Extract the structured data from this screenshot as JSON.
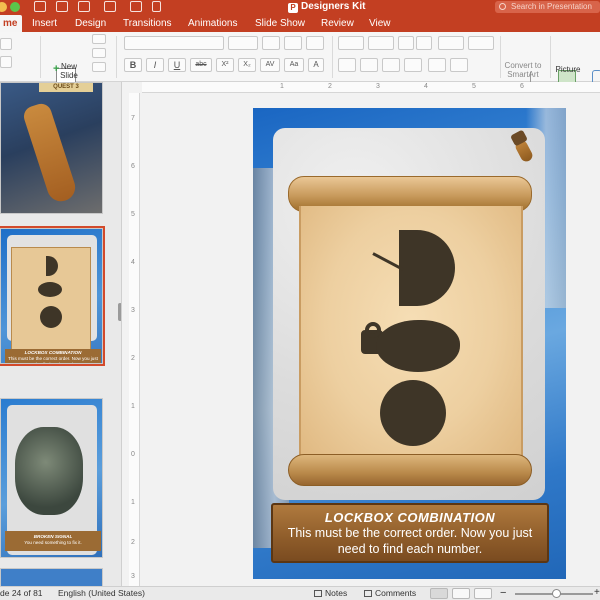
{
  "window": {
    "title": "Designers Kit",
    "app_badge": "P",
    "search_placeholder": "Search in Presentation"
  },
  "tabs": [
    {
      "label": "me",
      "active": true
    },
    {
      "label": "Insert"
    },
    {
      "label": "Design"
    },
    {
      "label": "Transitions"
    },
    {
      "label": "Animations"
    },
    {
      "label": "Slide Show"
    },
    {
      "label": "Review"
    },
    {
      "label": "View"
    }
  ],
  "ribbon": {
    "new_slide_label": "New\nSlide",
    "convert_label": "Convert to\nSmartArt",
    "picture_label": "Picture",
    "format_buttons": [
      "B",
      "I",
      "U",
      "abc",
      "X²",
      "X₂",
      "AV",
      "Aa",
      "A"
    ]
  },
  "thumbnails": {
    "quest_label": "QUEST 3",
    "slide24_caption_title": "LOCKBOX COMBINATION",
    "slide24_caption_body": "This must be the correct order. Now you just need to find each number.",
    "slide25_caption_title": "BROKEN SIGNAL",
    "slide25_caption_body": "You need something to fix it."
  },
  "rulers": {
    "h_ticks": [
      "1",
      "2",
      "3",
      "4",
      "5",
      "6"
    ],
    "v_ticks": [
      "7",
      "6",
      "5",
      "4",
      "3",
      "2",
      "1",
      "0",
      "1",
      "2",
      "3"
    ]
  },
  "slide": {
    "caption_title": "LOCKBOX COMBINATION",
    "caption_body": "This must be the correct order. Now you just need to find each number."
  },
  "status": {
    "slide_indicator": "de 24 of 81",
    "language": "English (United States)",
    "notes_label": "Notes",
    "comments_label": "Comments"
  },
  "colors": {
    "accent": "#c33f22",
    "scroll": "#edcfa0",
    "silhouette": "#3e3527",
    "caption_board": "#8e5c2a"
  }
}
